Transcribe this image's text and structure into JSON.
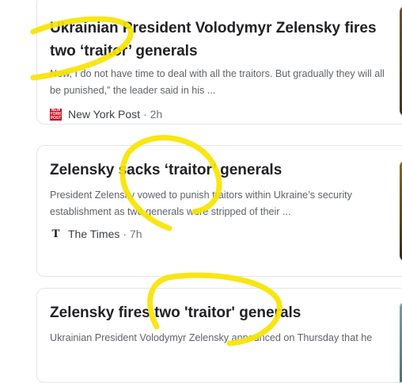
{
  "articles": [
    {
      "headline": "Ukrainian President Volodymyr Zelensky fires two ‘traitor’ generals",
      "snippet": "Now, I do not have time to deal with all the traitors. But gradually they will all be punished,” the leader said in his ...",
      "source": "New York Post",
      "source_icon": "new-york-post-logo",
      "time": "· 2h",
      "thumbnail_color": "#5a4628"
    },
    {
      "headline": "Zelensky sacks ‘traitor’ generals",
      "snippet": "President Zelensky vowed to punish traitors within Ukraine’s security establishment as two generals were stripped of their ...",
      "source": "The Times",
      "source_icon": "the-times-logo",
      "time": "· 7h",
      "thumbnail_color": "#6e5418"
    },
    {
      "headline": "Zelensky fires two 'traitor' generals",
      "snippet": "Ukrainian President Volodymyr Zelensky announced on Thursday that he",
      "thumbnail_color": "#6f9193"
    }
  ],
  "annotation_color": "#f7e400"
}
